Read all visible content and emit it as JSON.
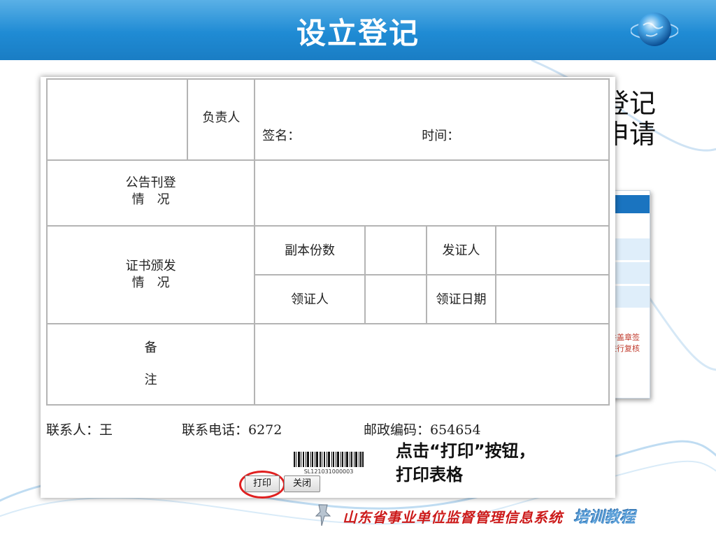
{
  "slide": {
    "title": "设立登记",
    "background_text": [
      "登记",
      "申请"
    ],
    "background_panel_red_text": [
      "并盖章签",
      "进行复核"
    ],
    "callout": [
      "点击“打印”按钮，",
      "打印表格"
    ],
    "footer": {
      "main": "山东省事业单位监督管理信息系统",
      "tag": "培训教程"
    }
  },
  "form": {
    "rows": {
      "responsible_person": "负责人",
      "signature_label": "签名：",
      "time_label": "时间：",
      "announcement": [
        "公告刊登",
        "情　况"
      ],
      "certificate": [
        "证书颁发",
        "情　况"
      ],
      "copies": "副本份数",
      "issuer": "发证人",
      "recipient": "领证人",
      "receive_date": "领证日期",
      "remarks": [
        "备",
        "注"
      ]
    },
    "contact": {
      "person": "联系人：王",
      "phone": "联系电话：6272",
      "postal": "邮政编码：654654"
    },
    "barcode_text": "SL121031000003",
    "buttons": {
      "print": "打印",
      "close": "关闭"
    }
  },
  "colors": {
    "title_band": "#1f8bd4",
    "highlight": "#e02020",
    "footer_red": "#cc1a1a"
  }
}
